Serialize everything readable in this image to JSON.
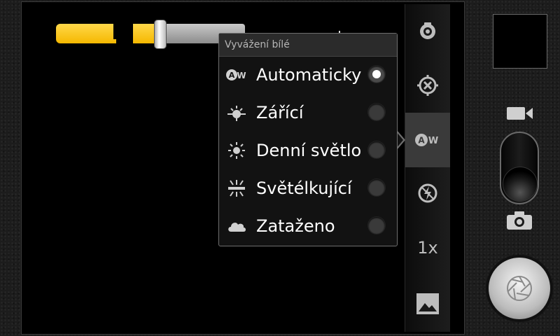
{
  "popup": {
    "title": "Vyvážení bílé",
    "options": [
      {
        "label": "Automaticky",
        "icon": "auto-wb-icon",
        "selected": true
      },
      {
        "label": "Zářící",
        "icon": "incandescent-icon",
        "selected": false
      },
      {
        "label": "Denní světlo",
        "icon": "daylight-icon",
        "selected": false
      },
      {
        "label": "Světélkující",
        "icon": "fluorescent-icon",
        "selected": false
      },
      {
        "label": "Zataženo",
        "icon": "cloudy-icon",
        "selected": false
      }
    ]
  },
  "toolbar": {
    "items": [
      "camera-settings-icon",
      "focus-icon",
      "white-balance-icon",
      "flash-off-icon",
      "zoom-level",
      "gallery-icon"
    ],
    "selected": "white-balance-icon",
    "zoom_level": "1x"
  },
  "zoom_slider": {
    "level": 0.25
  },
  "controls": {
    "mode": "camera",
    "icons": [
      "video-icon",
      "camera-icon",
      "shutter-icon"
    ]
  },
  "colors": {
    "accent": "#f5b800",
    "panel": "#121212",
    "selected_tool": "#3a3a3a"
  }
}
